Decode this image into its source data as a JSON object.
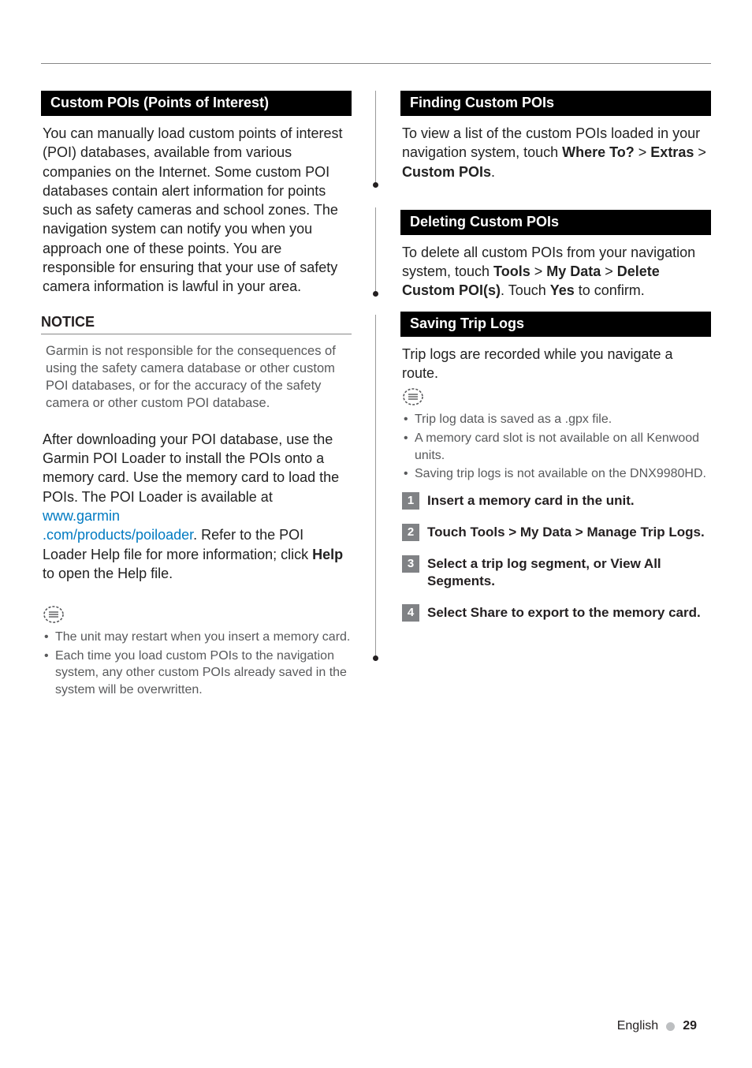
{
  "left": {
    "sections": {
      "custom_pois": {
        "title": "Custom POIs (Points of Interest)",
        "intro": "You can manually load custom points of interest (POI) databases, available from various companies on the Internet. Some custom POI databases contain alert information for points such as safety cameras and school zones. The navigation system can notify you when you approach one of these points. You are responsible for ensuring that your use of safety camera information is lawful in your area.",
        "notice_heading": "NOTICE",
        "notice_text": "Garmin is not responsible for the consequences of using the safety camera database or other custom POI databases, or for the accuracy of the safety camera or other custom POI database.",
        "after_pre": "After downloading your POI database, use the Garmin POI Loader to install the POIs onto a memory card. Use the memory card to load the POIs. The POI Loader is available at ",
        "link1": "www.garmin",
        "link2": ".com/products/poiloader",
        "after_mid": ". Refer to the POI Loader Help file for more information; click ",
        "help_word": "Help",
        "after_end": " to open the Help file.",
        "tips": [
          "The unit may restart when you insert a memory card.",
          "Each time you load custom POIs to the navigation system, any other custom POIs already saved in the system will be overwritten."
        ]
      }
    }
  },
  "right": {
    "finding": {
      "title": "Finding Custom POIs",
      "pre": "To view a list of the custom POIs loaded in your navigation system, touch ",
      "b1": "Where To?",
      "gt1": " > ",
      "b2": "Extras",
      "gt2": " > ",
      "b3": "Custom POIs",
      "period": "."
    },
    "deleting": {
      "title": "Deleting Custom POIs",
      "pre": "To delete all custom POIs from your navigation system, touch ",
      "b1": "Tools",
      "gt1": " > ",
      "b2": "My Data",
      "gt2": " > ",
      "b3": "Delete Custom POI(s)",
      "mid": ". Touch ",
      "b4": "Yes",
      "end": " to confirm."
    },
    "saving": {
      "title": "Saving Trip Logs",
      "intro": "Trip logs are recorded while you navigate a route.",
      "notes": [
        "Trip log data is saved as a .gpx file.",
        "A memory card slot is not available on all Kenwood units.",
        "Saving trip logs is not available on the DNX9980HD."
      ],
      "steps": [
        {
          "n": "1",
          "text": "Insert a memory card in the unit."
        },
        {
          "n": "2",
          "text": "Touch Tools > My Data > Manage Trip Logs."
        },
        {
          "n": "3",
          "text": "Select a trip log segment, or View All Segments."
        },
        {
          "n": "4",
          "text": "Select Share to export to the memory card."
        }
      ]
    }
  },
  "footer": {
    "lang": "English",
    "page": "29"
  }
}
